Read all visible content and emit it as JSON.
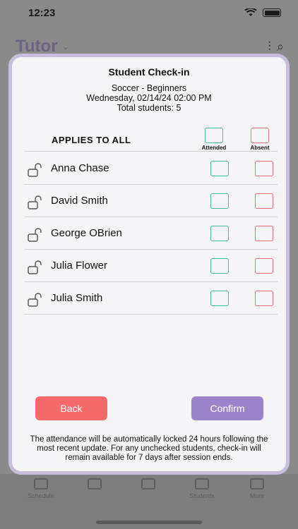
{
  "status_bar": {
    "time": "12:23"
  },
  "background": {
    "title": "Tutor",
    "tabs": [
      {
        "label": "Schedule",
        "icon": "calendar-icon"
      },
      {
        "label": "",
        "icon": "chat-icon"
      },
      {
        "label": "",
        "icon": "board-icon"
      },
      {
        "label": "Students",
        "icon": "flag-icon"
      },
      {
        "label": "More",
        "icon": "more-icon"
      }
    ]
  },
  "modal": {
    "title": "Student Check-in",
    "class_name": "Soccer - Beginners",
    "datetime": "Wednesday, 02/14/24 02:00 PM",
    "total": "Total students: 5",
    "applies_label": "APPLIES TO ALL",
    "attended_label": "Attended",
    "absent_label": "Absent",
    "students": [
      {
        "name": "Anna Chase"
      },
      {
        "name": "David Smith"
      },
      {
        "name": "George OBrien"
      },
      {
        "name": "Julia Flower"
      },
      {
        "name": "Julia Smith"
      }
    ],
    "back_label": "Back",
    "confirm_label": "Confirm",
    "note": "The attendance will be automatically locked 24 hours following the most recent update. For any unchecked students, check-in will remain available for 7 days after session ends."
  },
  "colors": {
    "attended": "#43b89a",
    "absent": "#e86f72",
    "back_button": "#f46a6a",
    "confirm_button": "#9b83c9",
    "modal_border": "#c8bedc"
  }
}
